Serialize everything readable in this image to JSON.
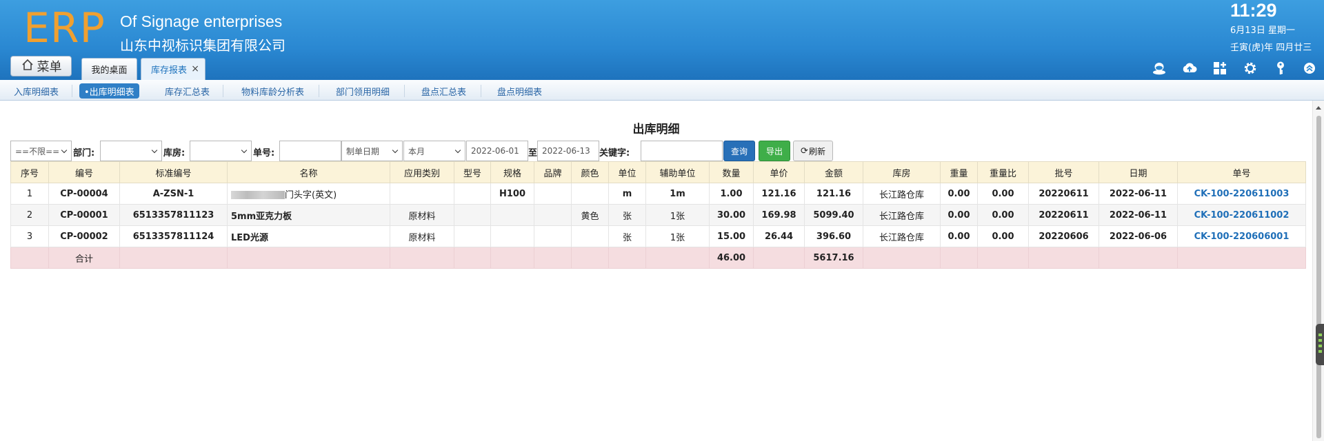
{
  "header": {
    "logo": "ERP",
    "company_en": "Of Signage enterprises",
    "company_cn": "山东中视标识集团有限公司",
    "clock": "11:29",
    "date": "6月13日 星期一",
    "lunar": "壬寅(虎)年 四月廿三",
    "menu_label": "菜单",
    "tabs": [
      {
        "label": "我的桌面"
      },
      {
        "label": "库存报表",
        "close": "×"
      }
    ],
    "icons": [
      "user-icon",
      "cloud-upload-icon",
      "apps-icon",
      "settings-gear-icon",
      "key-icon",
      "collapse-up-icon"
    ]
  },
  "subnav": [
    {
      "label": "入库明细表"
    },
    {
      "label": "•出库明细表",
      "active": true
    },
    {
      "label": "库存汇总表"
    },
    {
      "label": "物料库龄分析表"
    },
    {
      "label": "部门领用明细"
    },
    {
      "label": "盘点汇总表"
    },
    {
      "label": "盘点明细表"
    }
  ],
  "page": {
    "title": "出库明细",
    "filters": {
      "scope_select": "==不限==",
      "dept_label": "部门:",
      "dept_value": "",
      "store_label": "库房:",
      "store_value": "",
      "doc_label": "单号:",
      "doc_value": "",
      "date_type": "制单日期",
      "period": "本月",
      "date_from": "2022-06-01",
      "to_label": "至",
      "date_to": "2022-06-13",
      "keyword_label": "关键字:",
      "keyword_value": "",
      "query_button": "查询",
      "export_button": "导出",
      "refresh_button": "刷新"
    },
    "table": {
      "columns": [
        "序号",
        "编号",
        "标准编号",
        "名称",
        "应用类别",
        "型号",
        "规格",
        "品牌",
        "颜色",
        "单位",
        "辅助单位",
        "数量",
        "单价",
        "金额",
        "库房",
        "重量",
        "重量比",
        "批号",
        "日期",
        "单号"
      ],
      "rows": [
        {
          "seq": "1",
          "code": "CP-00004",
          "std_code": "A-ZSN-1",
          "name": "门头字(英文)",
          "category": "",
          "model": "",
          "spec": "H100",
          "brand": "",
          "color": "",
          "unit": "m",
          "aux_unit": "1m",
          "qty": "1.00",
          "price": "121.16",
          "amount": "121.16",
          "store": "长江路仓库",
          "weight": "0.00",
          "weight_ratio": "0.00",
          "batch": "20220611",
          "date": "2022-06-11",
          "doc_no": "CK-100-220611003"
        },
        {
          "seq": "2",
          "code": "CP-00001",
          "std_code": "6513357811123",
          "name": "5mm亚克力板",
          "category": "原材料",
          "model": "",
          "spec": "",
          "brand": "",
          "color": "黄色",
          "unit": "张",
          "aux_unit": "1张",
          "qty": "30.00",
          "price": "169.98",
          "amount": "5099.40",
          "store": "长江路仓库",
          "weight": "0.00",
          "weight_ratio": "0.00",
          "batch": "20220611",
          "date": "2022-06-11",
          "doc_no": "CK-100-220611002"
        },
        {
          "seq": "3",
          "code": "CP-00002",
          "std_code": "6513357811124",
          "name": "LED光源",
          "category": "原材料",
          "model": "",
          "spec": "",
          "brand": "",
          "color": "",
          "unit": "张",
          "aux_unit": "1张",
          "qty": "15.00",
          "price": "26.44",
          "amount": "396.60",
          "store": "长江路仓库",
          "weight": "0.00",
          "weight_ratio": "0.00",
          "batch": "20220606",
          "date": "2022-06-06",
          "doc_no": "CK-100-220606001"
        }
      ],
      "total": {
        "label": "合计",
        "qty": "46.00",
        "amount": "5617.16"
      }
    }
  }
}
